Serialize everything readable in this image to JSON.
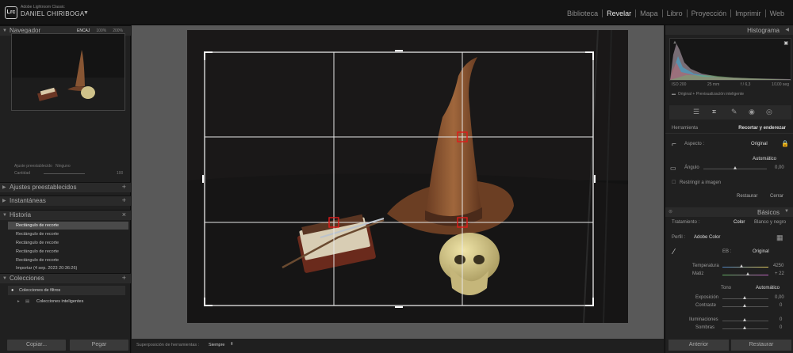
{
  "app": {
    "logo": "Lrc",
    "product": "Adobe Lightroom Classic",
    "user": "DANIEL CHIRIBOGA",
    "caret": "▼"
  },
  "modules": [
    {
      "label": "Biblioteca",
      "active": false
    },
    {
      "label": "Revelar",
      "active": true
    },
    {
      "label": "Mapa",
      "active": false
    },
    {
      "label": "Libro",
      "active": false
    },
    {
      "label": "Proyección",
      "active": false
    },
    {
      "label": "Imprimir",
      "active": false
    },
    {
      "label": "Web",
      "active": false
    }
  ],
  "left": {
    "navigator": {
      "title": "Navegador",
      "zoom": [
        "ENCAJ",
        "100%",
        "200%"
      ]
    },
    "preset_amount": {
      "label": "Ajuste preestablecido",
      "value": "Ninguno",
      "amount_label": "Cantidad",
      "amount_value": "100"
    },
    "sections": {
      "presets": "Ajustes preestablecidos",
      "snapshots": "Instantáneas",
      "history": "Historia",
      "collections": "Colecciones"
    },
    "history": [
      {
        "label": "Rectángulo de recorte",
        "selected": true
      },
      {
        "label": "Rectángulo de recorte",
        "selected": false
      },
      {
        "label": "Rectángulo de recorte",
        "selected": false
      },
      {
        "label": "Rectángulo de recorte",
        "selected": false
      },
      {
        "label": "Rectángulo de recorte",
        "selected": false
      },
      {
        "label": "Importar (4 sep. 2023 20:36:26)",
        "selected": false
      }
    ],
    "collections": {
      "filters": "Colecciones de filtros",
      "smart": "Colecciones inteligentes"
    },
    "copy": "Copiar...",
    "paste": "Pegar"
  },
  "bottombar": {
    "overlay_label": "Superposición de herramientas :",
    "overlay_value": "Siempre"
  },
  "right": {
    "histogram_title": "Histograma",
    "hist_info": [
      "ISO 200",
      "25 mm",
      "f / 6,3",
      "1/100 seg"
    ],
    "original_preview": "Original + Previsualización inteligente",
    "tool_label": "Herramienta",
    "tool_name": "Recortar y enderezar",
    "aspect_label": "Aspecto :",
    "aspect_value": "Original",
    "auto": "Automático",
    "angle_label": "Ángulo",
    "angle_value": "0,00",
    "constrain": "Restringir a imagen",
    "restore": "Restaurar",
    "close": "Cerrar",
    "basic_title": "Básicos",
    "treatment_label": "Tratamiento :",
    "treatment_color": "Color",
    "treatment_bw": "Blanco y negro",
    "profile_label": "Perfil :",
    "profile_value": "Adobe Color",
    "wb_label": "EB :",
    "wb_value": "Original",
    "temp_label": "Temperatura",
    "temp_value": "4250",
    "tint_label": "Matiz",
    "tint_value": "+ 22",
    "tone_label": "Tono",
    "tone_auto": "Automático",
    "exposure_label": "Exposición",
    "exposure_value": "0,00",
    "contrast_label": "Contraste",
    "contrast_value": "0",
    "highlights_label": "Iluminaciones",
    "highlights_value": "0",
    "shadows_label": "Sombras",
    "shadows_value": "0",
    "previous": "Anterior",
    "reset": "Restaurar"
  }
}
